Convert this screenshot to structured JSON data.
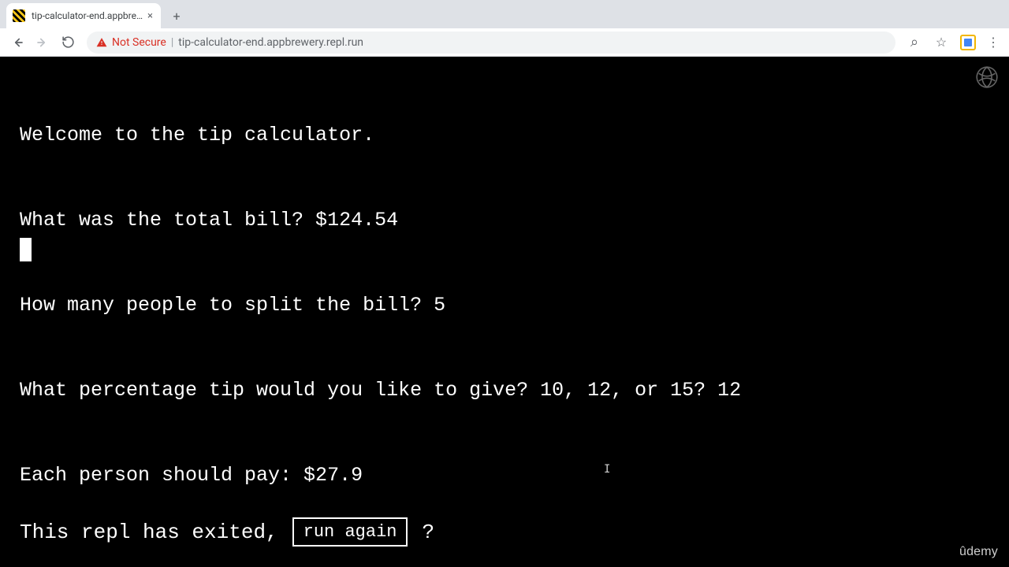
{
  "browser": {
    "tab_title": "tip-calculator-end.appbrewery.r",
    "new_tab_plus": "+",
    "close_x": "×",
    "not_secure": "Not Secure",
    "url": "tip-calculator-end.appbrewery.repl.run",
    "sep": "|",
    "star": "☆",
    "search_glyph": "⌕",
    "dots": "⋮"
  },
  "terminal": {
    "lines": [
      "Welcome to the tip calculator.",
      "What was the total bill? $124.54",
      "How many people to split the bill? 5",
      "What percentage tip would you like to give? 10, 12, or 15? 12",
      "Each person should pay: $27.9"
    ]
  },
  "exit": {
    "prefix": "This repl has exited,",
    "button": "run again",
    "suffix": "?"
  },
  "watermark": "ûdemy"
}
